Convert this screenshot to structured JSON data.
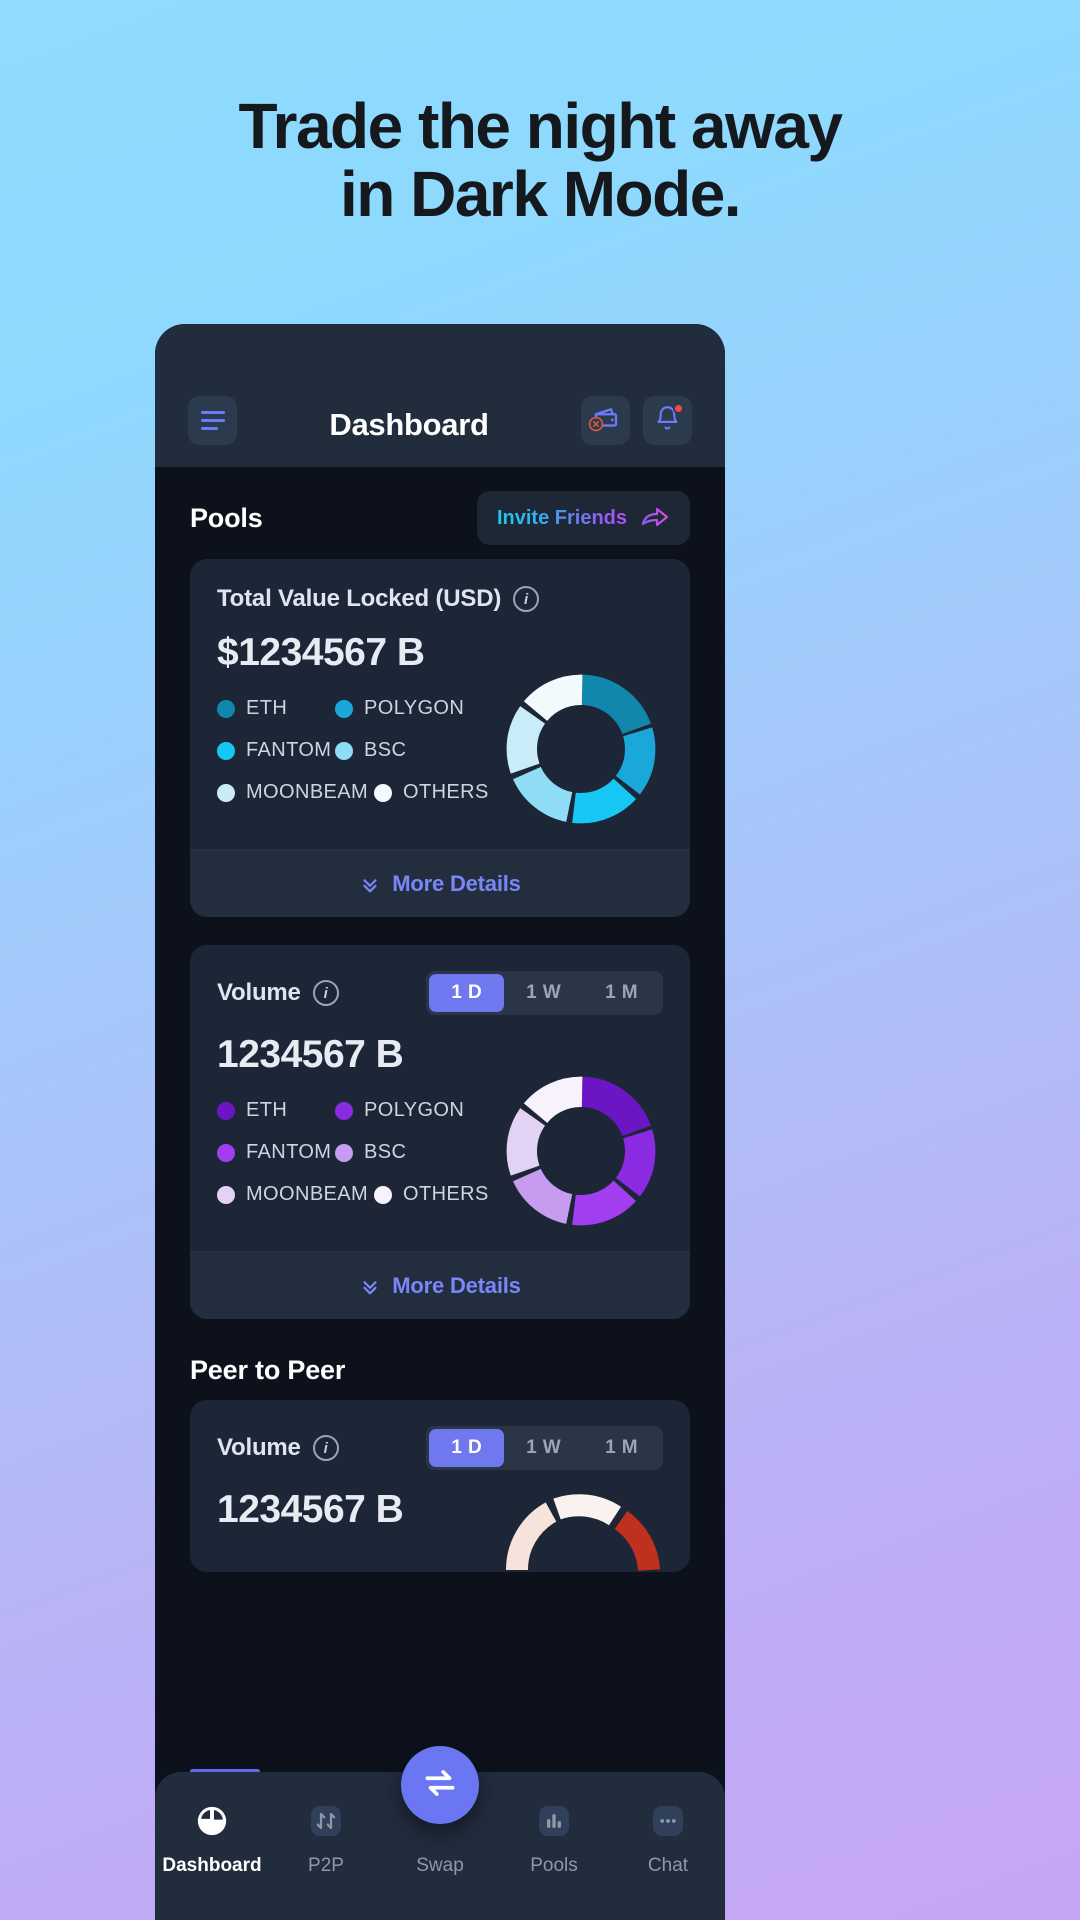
{
  "headline": {
    "line1": "Trade the night away",
    "line2": "in Dark Mode."
  },
  "topbar": {
    "title": "Dashboard",
    "menu_icon": "hamburger-menu-icon",
    "wallet_icon": "wallet-disconnected-icon",
    "bell_icon": "notification-bell-icon"
  },
  "pools": {
    "section_title": "Pools",
    "invite_label": "Invite Friends",
    "invite_icon": "share-arrow-icon",
    "tvl_card": {
      "title": "Total Value Locked (USD)",
      "info_icon": "info-icon",
      "value": "$1234567 B",
      "more_label": "More Details",
      "more_icon": "double-chevron-down-icon"
    },
    "volume_card": {
      "title": "Volume",
      "info_icon": "info-icon",
      "value": "1234567 B",
      "ranges": [
        "1 D",
        "1 W",
        "1 M"
      ],
      "active_range": "1 D",
      "more_label": "More Details",
      "more_icon": "double-chevron-down-icon"
    }
  },
  "p2p": {
    "section_title": "Peer to Peer",
    "volume_card": {
      "title": "Volume",
      "info_icon": "info-icon",
      "value": "1234567 B",
      "ranges": [
        "1 D",
        "1 W",
        "1 M"
      ],
      "active_range": "1 D"
    }
  },
  "nav": {
    "items": [
      {
        "label": "Dashboard",
        "icon": "pie-chart-icon",
        "active": true
      },
      {
        "label": "P2P",
        "icon": "swap-arrows-icon",
        "active": false
      },
      {
        "label": "Swap",
        "icon": "exchange-arrows-icon",
        "active": false
      },
      {
        "label": "Pools",
        "icon": "bar-chart-icon",
        "active": false
      },
      {
        "label": "Chat",
        "icon": "chat-bubble-icon",
        "active": false
      }
    ]
  },
  "colors": {
    "accent": "#6a76f2",
    "card_bg": "#1c2636",
    "screen_bg": "#0c111b",
    "topbar_bg": "#212c3d",
    "badge_red": "#ef4a4a"
  },
  "chart_data": [
    {
      "type": "pie",
      "title": "Total Value Locked (USD)",
      "legend_position": "left",
      "categories": [
        "ETH",
        "POLYGON",
        "FANTOM",
        "BSC",
        "MOONBEAM",
        "OTHERS"
      ],
      "values": [
        20,
        16,
        16,
        16,
        16,
        16
      ],
      "colors": [
        "#1287ad",
        "#1aa8da",
        "#16c7f5",
        "#8fdcf7",
        "#c9ecf9",
        "#f2fafd"
      ]
    },
    {
      "type": "pie",
      "title": "Volume",
      "legend_position": "left",
      "categories": [
        "ETH",
        "POLYGON",
        "FANTOM",
        "BSC",
        "MOONBEAM",
        "OTHERS"
      ],
      "values": [
        20,
        16,
        16,
        16,
        16,
        16
      ],
      "colors": [
        "#6b16c4",
        "#8a2be2",
        "#a33df0",
        "#c69bf0",
        "#e2d3f5",
        "#f7f2fc"
      ]
    },
    {
      "type": "gauge",
      "title": "Peer to Peer Volume",
      "segments": [
        "low",
        "high"
      ],
      "colors": [
        "#f6e3db",
        "#c0301f"
      ]
    }
  ]
}
